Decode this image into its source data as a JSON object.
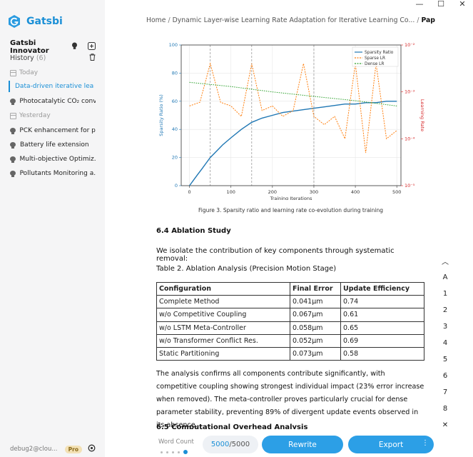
{
  "window": {
    "minimize": "—",
    "maximize": "☐",
    "close": "✕"
  },
  "sidebar": {
    "brand": "Gatsbi",
    "account": "Gatsbi Innovator",
    "history_label": "History",
    "history_count": "(6)",
    "groups": [
      {
        "label": "Today",
        "items": [
          "Data-driven iterative learn...",
          "Photocatalytic CO₂ conv..."
        ]
      },
      {
        "label": "Yesterday",
        "items": [
          "PCK enhancement for p...",
          "Battery life extension",
          "Multi-objective Optimiz...",
          "Pollutants Monitoring a..."
        ]
      }
    ],
    "active_item": "Data-driven iterative learn...",
    "user": "debug2@clou...",
    "badge": "Pro"
  },
  "breadcrumb": {
    "home": "Home",
    "sep": "/",
    "paper": "Dynamic Layer-wise Learning Rate Adaptation for Iterative Learning Co...",
    "current": "Paper Manuscript"
  },
  "figure": {
    "caption": "Figure 3. Sparsity ratio and learning rate co-evolution during training"
  },
  "chart_data": {
    "type": "line",
    "xlabel": "Training Iterations",
    "ylabel": "Sparsity Ratio (%)",
    "y2label": "Learning Rate",
    "xlim": [
      -20,
      510
    ],
    "ylim": [
      0,
      100
    ],
    "xticks": [
      0,
      100,
      200,
      300,
      400,
      500
    ],
    "yticks": [
      0,
      20,
      40,
      60,
      80,
      100
    ],
    "y2ticks": [
      "10⁻⁵",
      "10⁻⁴",
      "10⁻³",
      "10⁻²"
    ],
    "y2_scale": "log",
    "y2lim": [
      1e-05,
      0.01
    ],
    "grid": true,
    "legend_position": "top-right",
    "vlines": [
      50,
      150,
      300
    ],
    "series": [
      {
        "name": "Sparsity Ratio",
        "color": "#1f77b4",
        "axis": "left",
        "x": [
          0,
          10,
          20,
          30,
          40,
          50,
          60,
          80,
          100,
          125,
          150,
          175,
          200,
          225,
          250,
          275,
          300,
          325,
          350,
          375,
          400,
          425,
          450,
          475,
          500
        ],
        "y": [
          0,
          4,
          8,
          12,
          16,
          20,
          23,
          29,
          34,
          40,
          45,
          48,
          50,
          52,
          53,
          54,
          55,
          56,
          57,
          58,
          58,
          59,
          59,
          60,
          60
        ]
      },
      {
        "name": "Sparse LR",
        "color": "#ff7f0e",
        "axis": "right",
        "x": [
          0,
          25,
          50,
          75,
          100,
          125,
          150,
          175,
          200,
          225,
          250,
          275,
          300,
          325,
          350,
          375,
          400,
          425,
          450,
          475,
          500
        ],
        "y": [
          0.0005,
          0.0006,
          0.004,
          0.0006,
          0.0005,
          0.0003,
          0.004,
          0.0004,
          0.0005,
          0.0003,
          0.0004,
          0.004,
          0.0003,
          0.0002,
          0.0003,
          0.0001,
          0.004,
          5e-05,
          0.004,
          0.0001,
          0.00015
        ]
      },
      {
        "name": "Dense LR",
        "color": "#2ca02c",
        "axis": "right",
        "x": [
          0,
          100,
          200,
          300,
          400,
          500
        ],
        "y": [
          0.0016,
          0.0013,
          0.001,
          0.0008,
          0.00065,
          0.0005
        ]
      }
    ]
  },
  "section": {
    "heading": "6.4 Ablation Study",
    "intro": "We isolate the contribution of key components through systematic removal:",
    "table_caption": "Table 2. Ablation Analysis (Precision Motion Stage)",
    "table": {
      "headers": [
        "Configuration",
        "Final Error",
        "Update Efficiency"
      ],
      "rows": [
        [
          "Complete Method",
          "0.041μm",
          "0.74"
        ],
        [
          "w/o Competitive Coupling",
          "0.067μm",
          "0.61"
        ],
        [
          "w/o LSTM Meta-Controller",
          "0.058μm",
          "0.65"
        ],
        [
          "w/o Transformer Conflict Res.",
          "0.052μm",
          "0.69"
        ],
        [
          "Static Partitioning",
          "0.073μm",
          "0.58"
        ]
      ]
    },
    "analysis": "The analysis confirms all components contribute significantly, with competitive coupling showing strongest individual impact (23% error increase when removed). The meta-controller proves particularly crucial for dense parameter stability, preventing 89% of divergent update events observed in its absence.",
    "next_heading": "6.5 Computational Overhead Analysis"
  },
  "rail": {
    "up": "︿",
    "items": [
      "A",
      "1",
      "2",
      "3",
      "4",
      "5",
      "6",
      "7",
      "8"
    ],
    "close": "✕",
    "down": "﹀"
  },
  "bottom": {
    "word_count_label": "Word Count",
    "word_count_current": "5000",
    "word_count_total": "/5000",
    "rewrite": "Rewrite",
    "export": "Export",
    "export_more": "⋮"
  }
}
